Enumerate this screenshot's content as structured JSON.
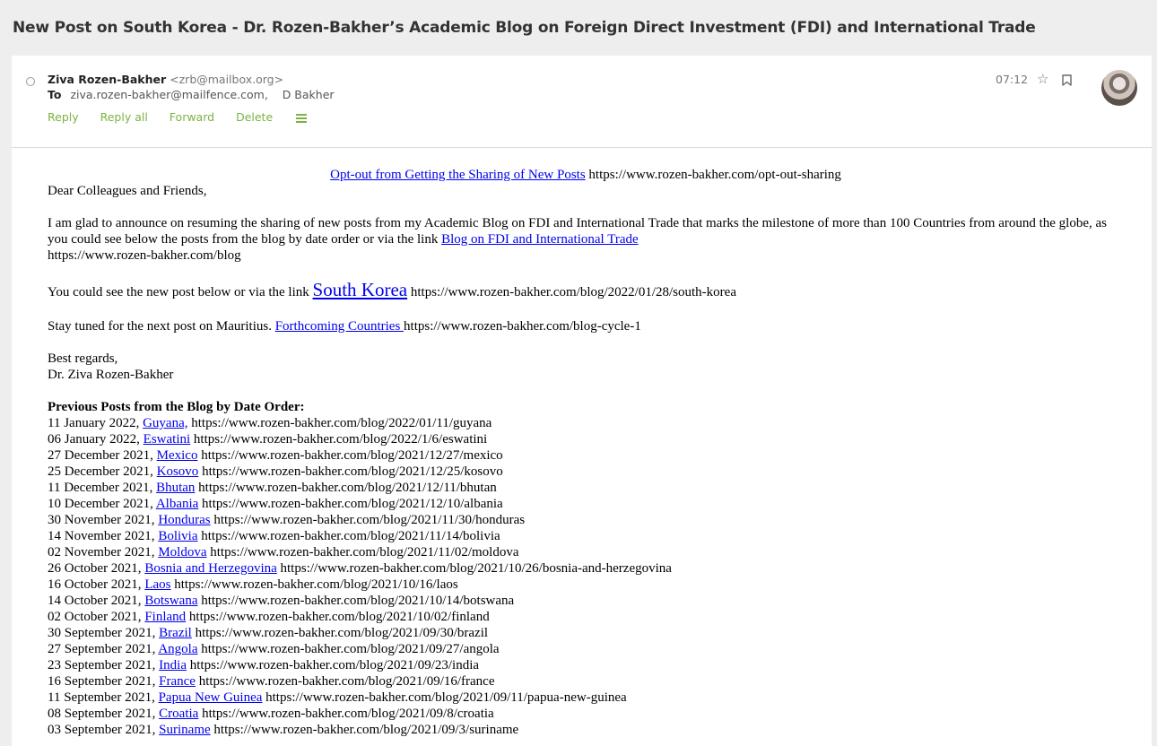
{
  "subject": "New Post on South Korea - Dr. Rozen-Bakher’s Academic Blog on Foreign Direct Investment (FDI) and International Trade",
  "header": {
    "from_name": "Ziva Rozen-Bakher",
    "from_addr": "<zrb@mailbox.org>",
    "to_label": "To",
    "to_recipients": "ziva.rozen-bakher@mailfence.com,    D Bakher",
    "time": "07:12",
    "actions": {
      "reply": "Reply",
      "reply_all": "Reply all",
      "forward": "Forward",
      "delete": "Delete"
    }
  },
  "body": {
    "optout_link": "Opt-out from Getting the Sharing of New Posts",
    "optout_url": " https://www.rozen-bakher.com/opt-out-sharing",
    "greeting": "Dear Colleagues and Friends,",
    "p1_text": "I am glad to announce on resuming the sharing of new posts from my Academic Blog on FDI and International Trade that marks the milestone of more than 100 Countries from around the globe, as you could see below the posts from the blog by date order or via the link ",
    "p1_link": "Blog on FDI and International Trade",
    "p1_url": "https://www.rozen-bakher.com/blog",
    "p2_text": "You could see the new post below or via the link ",
    "p2_link": "South Korea",
    "p2_url": " https://www.rozen-bakher.com/blog/2022/01/28/south-korea",
    "p3_text": "Stay tuned for the next post on Mauritius. ",
    "p3_link": "Forthcoming Countries ",
    "p3_url": "https://www.rozen-bakher.com/blog-cycle-1",
    "regards": "Best regards,",
    "signature": "Dr. Ziva Rozen-Bakher",
    "prev_heading": "Previous Posts from the Blog by Date Order:",
    "posts": [
      {
        "date": "11 January 2022, ",
        "country": "Guyana,",
        "url": " https://www.rozen-bakher.com/blog/2022/01/11/guyana"
      },
      {
        "date": "06 January 2022, ",
        "country": "Eswatini",
        "url": " https://www.rozen-bakher.com/blog/2022/1/6/eswatini"
      },
      {
        "date": "27 December 2021, ",
        "country": "Mexico",
        "url": " https://www.rozen-bakher.com/blog/2021/12/27/mexico"
      },
      {
        "date": "25 December 2021, ",
        "country": "Kosovo",
        "url": " https://www.rozen-bakher.com/blog/2021/12/25/kosovo"
      },
      {
        "date": "11 December 2021, ",
        "country": "Bhutan",
        "url": " https://www.rozen-bakher.com/blog/2021/12/11/bhutan"
      },
      {
        "date": "10 December 2021, ",
        "country": "Albania",
        "url": " https://www.rozen-bakher.com/blog/2021/12/10/albania"
      },
      {
        "date": "30 November 2021, ",
        "country": "Honduras",
        "url": " https://www.rozen-bakher.com/blog/2021/11/30/honduras"
      },
      {
        "date": "14 November 2021, ",
        "country": "Bolivia",
        "url": " https://www.rozen-bakher.com/blog/2021/11/14/bolivia"
      },
      {
        "date": "02 November 2021, ",
        "country": "Moldova",
        "url": " https://www.rozen-bakher.com/blog/2021/11/02/moldova"
      },
      {
        "date": "26 October 2021, ",
        "country": "Bosnia and Herzegovina",
        "url": " https://www.rozen-bakher.com/blog/2021/10/26/bosnia-and-herzegovina"
      },
      {
        "date": "16 October 2021, ",
        "country": "Laos",
        "url": " https://www.rozen-bakher.com/blog/2021/10/16/laos"
      },
      {
        "date": "14 October 2021, ",
        "country": "Botswana",
        "url": " https://www.rozen-bakher.com/blog/2021/10/14/botswana"
      },
      {
        "date": "02 October 2021, ",
        "country": "Finland",
        "url": " https://www.rozen-bakher.com/blog/2021/10/02/finland"
      },
      {
        "date": "30 September 2021, ",
        "country": "Brazil",
        "url": " https://www.rozen-bakher.com/blog/2021/09/30/brazil"
      },
      {
        "date": "27 September 2021, ",
        "country": "Angola",
        "url": " https://www.rozen-bakher.com/blog/2021/09/27/angola"
      },
      {
        "date": "23 September 2021, ",
        "country": "India",
        "url": " https://www.rozen-bakher.com/blog/2021/09/23/india"
      },
      {
        "date": "16 September 2021, ",
        "country": "France",
        "url": " https://www.rozen-bakher.com/blog/2021/09/16/france"
      },
      {
        "date": "11 September 2021, ",
        "country": "Papua New Guinea",
        "url": " https://www.rozen-bakher.com/blog/2021/09/11/papua-new-guinea"
      },
      {
        "date": "08 September 2021, ",
        "country": "Croatia",
        "url": " https://www.rozen-bakher.com/blog/2021/09/8/croatia"
      },
      {
        "date": "03 September 2021, ",
        "country": "Suriname",
        "url": " https://www.rozen-bakher.com/blog/2021/09/3/suriname"
      }
    ]
  },
  "icons": {
    "unread": "circle-icon",
    "star": "star-icon",
    "bookmark": "bookmark-icon",
    "menu": "hamburger-menu-icon"
  },
  "colors": {
    "action_green": "#7cb342",
    "link_blue": "#0000ee"
  }
}
